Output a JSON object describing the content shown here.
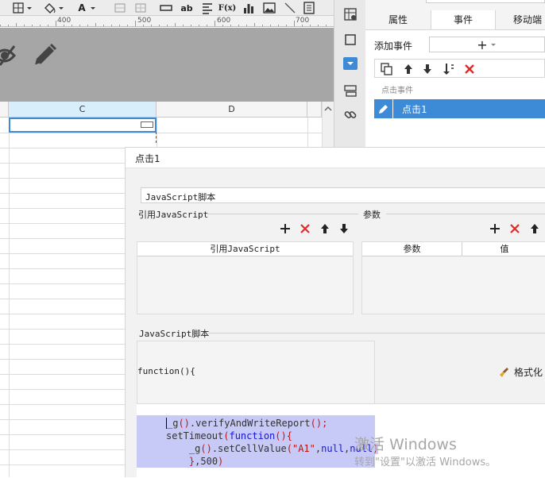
{
  "toolbar": {
    "text_button": "A",
    "ab_button": "ab",
    "formula_button": "F(x)"
  },
  "ruler": {
    "labels": [
      "400",
      "500",
      "600",
      "700"
    ]
  },
  "sheet": {
    "columns": [
      "C",
      "D"
    ]
  },
  "right_panel": {
    "tabs": [
      "属性",
      "事件",
      "移动端"
    ],
    "add_event_label": "添加事件",
    "add_symbol": "+",
    "event_section": "点击事件",
    "event_item": "点击1"
  },
  "dialog": {
    "title": "点击1",
    "type_select": "JavaScript脚本",
    "ref_js_label": "引用JavaScript",
    "params_label": "参数",
    "ref_js_header": "引用JavaScript",
    "param_header": "参数",
    "value_header": "值",
    "script_label": "JavaScript脚本",
    "function_header": "function(){",
    "format_button": "格式化",
    "code_lines": [
      "_g().verifyAndWriteReport();",
      "setTimeout(function(){",
      "    _g().setCellValue(\"A1\",null,null)",
      "    },500)"
    ]
  },
  "watermark": {
    "line1": "激活 Windows",
    "line2": "转到\"设置\"以激活 Windows。"
  },
  "colors": {
    "accent": "#3d8ad6",
    "delete_red": "#e02a2a",
    "selection": "#c7c9f7",
    "keyword": "#1818d6"
  }
}
